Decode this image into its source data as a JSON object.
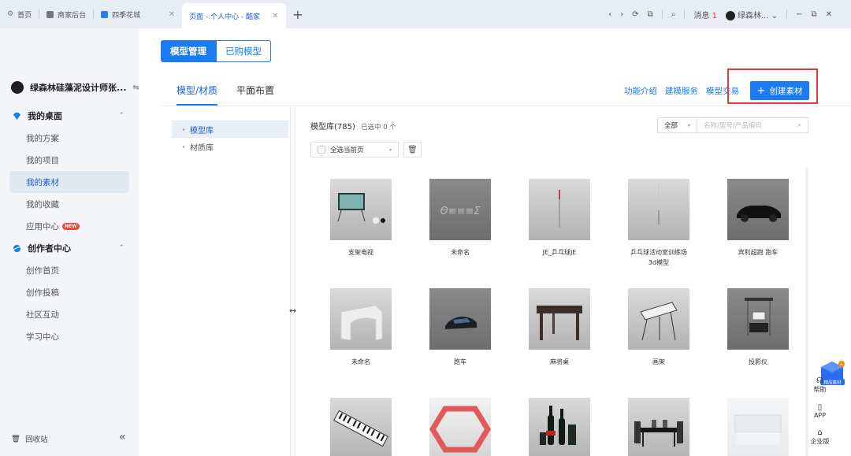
{
  "browser": {
    "tabs": [
      {
        "label": "首页"
      },
      {
        "label": "商家后台"
      },
      {
        "label": "四季花城"
      },
      {
        "label": "页面 - 个人中心 - 酷家"
      }
    ],
    "messages_label": "消息",
    "messages_count": "1",
    "user_short": "绿森林..."
  },
  "sidebar": {
    "brand": "绿森林硅藻泥设计师张...",
    "groups": [
      {
        "label": "我的桌面",
        "items": [
          "我的方案",
          "我的项目",
          "我的素材",
          "我的收藏",
          "应用中心"
        ]
      },
      {
        "label": "创作者中心",
        "items": [
          "创作首页",
          "创作投稿",
          "社区互动",
          "学习中心"
        ]
      }
    ],
    "new_badge": "NEW",
    "recycle": "回收站",
    "active_item": "我的素材"
  },
  "main": {
    "segment": {
      "active": "模型管理",
      "inactive": "已购模型"
    },
    "subtabs": [
      "模型/材质",
      "平面布置"
    ],
    "top_links": [
      "功能介绍",
      "建模服务",
      "模型交易"
    ],
    "create_label": "创建素材",
    "tree": [
      "模型库",
      "材质库"
    ],
    "library_title": "模型库(785)",
    "selected_text": "已选中 0 个",
    "filter_all": "全部",
    "search_placeholder": "名称/型号/产品编码",
    "select_page": "全选当前页",
    "items": [
      {
        "caption": "支架电视",
        "kind": "tv"
      },
      {
        "caption": "未命名",
        "kind": "text3d"
      },
      {
        "caption": "JE_乒乓球JE",
        "kind": "pole"
      },
      {
        "caption": "乒乓球活动室训练场\n3d模型",
        "kind": "stick"
      },
      {
        "caption": "宾利超跑 跑车",
        "kind": "car-dark"
      },
      {
        "caption": "未命名",
        "kind": "arch"
      },
      {
        "caption": "跑车",
        "kind": "car"
      },
      {
        "caption": "麻将桌",
        "kind": "table"
      },
      {
        "caption": "画架",
        "kind": "easel"
      },
      {
        "caption": "投影仪",
        "kind": "projector"
      },
      {
        "caption": "",
        "kind": "keyboard"
      },
      {
        "caption": "",
        "kind": "hexagon"
      },
      {
        "caption": "",
        "kind": "bottles"
      },
      {
        "caption": "",
        "kind": "dining"
      },
      {
        "caption": "",
        "kind": "glass"
      }
    ]
  },
  "float": {
    "help": "帮助",
    "app": "APP",
    "enterprise": "企业版",
    "badge": "精品素材"
  }
}
